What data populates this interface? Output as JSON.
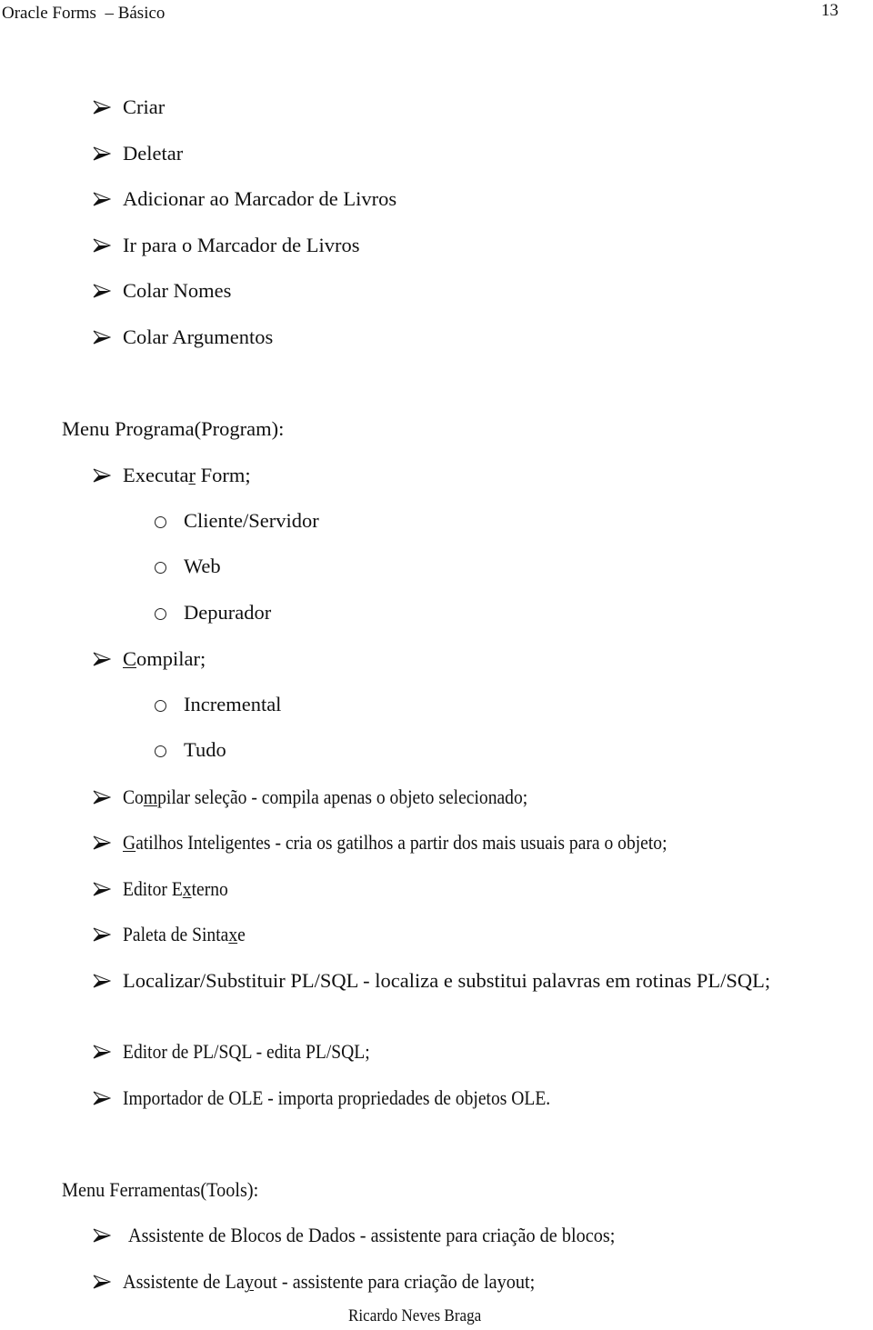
{
  "header": {
    "title": "Oracle Forms  – Básico",
    "page_number": "13"
  },
  "edit_menu_items": [
    {
      "label": "Criar"
    },
    {
      "label": "Deletar"
    },
    {
      "label": "Adicionar ao Marcador de Livros"
    },
    {
      "label": "Ir para o Marcador de Livros"
    },
    {
      "label": "Colar Nomes"
    },
    {
      "label": "Colar Argumentos"
    }
  ],
  "program_menu": {
    "heading": "Menu Programa(Program):",
    "executar": {
      "pre": "Executa",
      "mnemonic": "r",
      "post": " Form;",
      "subitems": [
        "Cliente/Servidor",
        "Web",
        "Depurador"
      ]
    },
    "compilar": {
      "pre": "",
      "mnemonic": "C",
      "post": "ompilar;",
      "subitems": [
        "Incremental",
        "Tudo"
      ]
    },
    "compilar_selecao": {
      "pre": "Co",
      "mnemonic": "m",
      "post": "pilar seleção - compila apenas o objeto selecionado;"
    },
    "gatilhos": {
      "pre": "",
      "mnemonic": "G",
      "post": "atilhos Inteligentes - cria os gatilhos a partir dos mais usuais para o objeto;"
    },
    "editor_externo": {
      "pre": "Editor E",
      "mnemonic": "x",
      "post": "terno"
    },
    "paleta": {
      "pre": "Paleta de Sinta",
      "mnemonic": "x",
      "post": "e"
    },
    "localizar": "Localizar/Substituir PL/SQL - localiza e substitui palavras em rotinas PL/SQL;",
    "editor_plsql": "Editor de PL/SQL - edita PL/SQL;",
    "importador_ole": "Importador de OLE - importa propriedades de objetos OLE."
  },
  "tools_menu": {
    "heading": "Menu Ferramentas(Tools):",
    "assistente_blocos": "Assistente de Blocos de Dados - assistente para criação de blocos;",
    "assistente_layout": {
      "pre": "Assistente de La",
      "mnemonic": "y",
      "post": "out - assistente para criação de layout;"
    }
  },
  "footer": {
    "author": "Ricardo Neves Braga"
  },
  "icons": {
    "arrow_bullet": "arrowhead-bullet-icon",
    "circle_bullet": "hollow-circle-bullet-icon"
  }
}
